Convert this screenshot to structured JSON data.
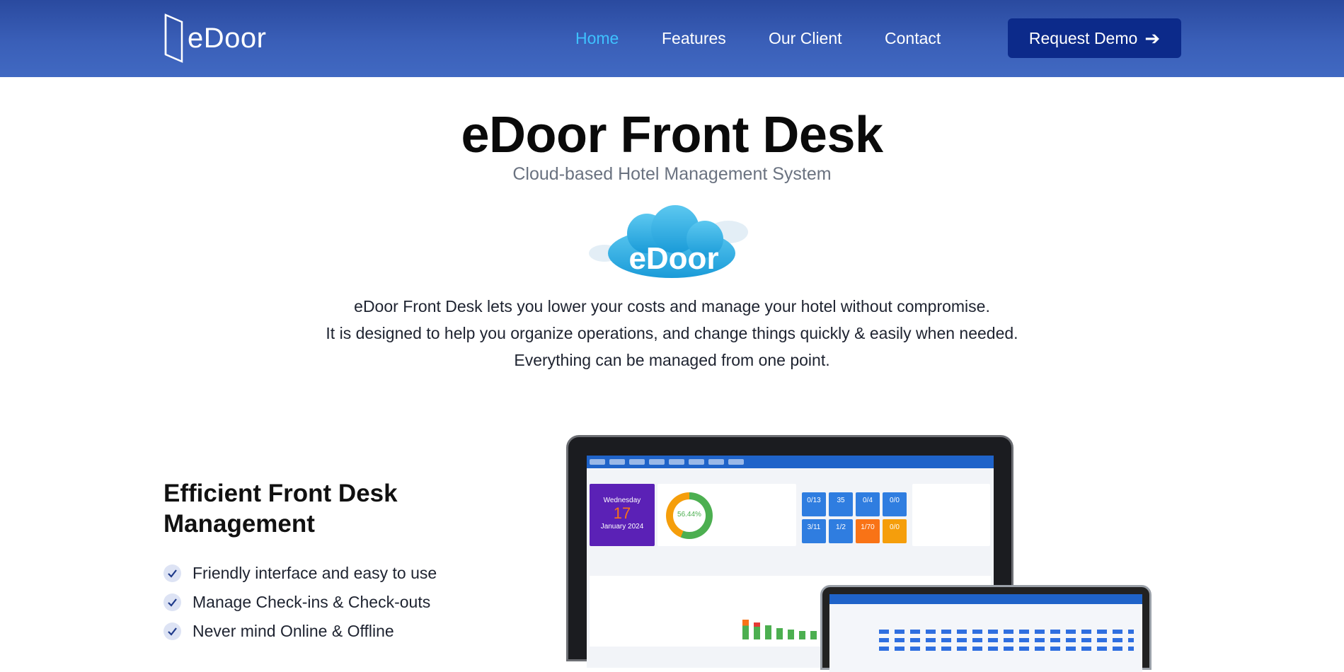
{
  "header": {
    "logo_text": "eDoor",
    "nav": [
      {
        "label": "Home",
        "active": true
      },
      {
        "label": "Features",
        "active": false
      },
      {
        "label": "Our Client",
        "active": false
      },
      {
        "label": "Contact",
        "active": false
      }
    ],
    "cta_label": "Request Demo",
    "cta_icon": "arrow-right-icon"
  },
  "hero": {
    "title": "eDoor Front Desk",
    "subtitle": "Cloud-based Hotel Management System",
    "cloud_logo_text": "eDoor",
    "intro_lines": [
      "eDoor Front Desk lets you lower your costs and manage your hotel without compromise.",
      "It is designed to help you organize operations, and change things quickly & easily when needed.",
      "Everything can be managed from one point."
    ]
  },
  "features": {
    "title": "Efficient Front Desk Management",
    "items": [
      "Friendly interface and easy to use",
      "Manage Check-ins & Check-outs",
      "Never mind Online & Offline"
    ],
    "check_icon": "check-icon"
  },
  "mockup": {
    "date_weekday": "Wednesday",
    "date_day": "17",
    "date_month": "January 2024",
    "occupancy": "56.44%",
    "tiles": [
      "0/13",
      "35",
      "0/4",
      "0/0",
      "3/11",
      "1/2",
      "1/70",
      "0/0"
    ]
  },
  "colors": {
    "header_bg": "#3a5fb8",
    "nav_active": "#3ec1ff",
    "cta_bg": "#0c2a8a",
    "subtitle": "#6a7280"
  }
}
